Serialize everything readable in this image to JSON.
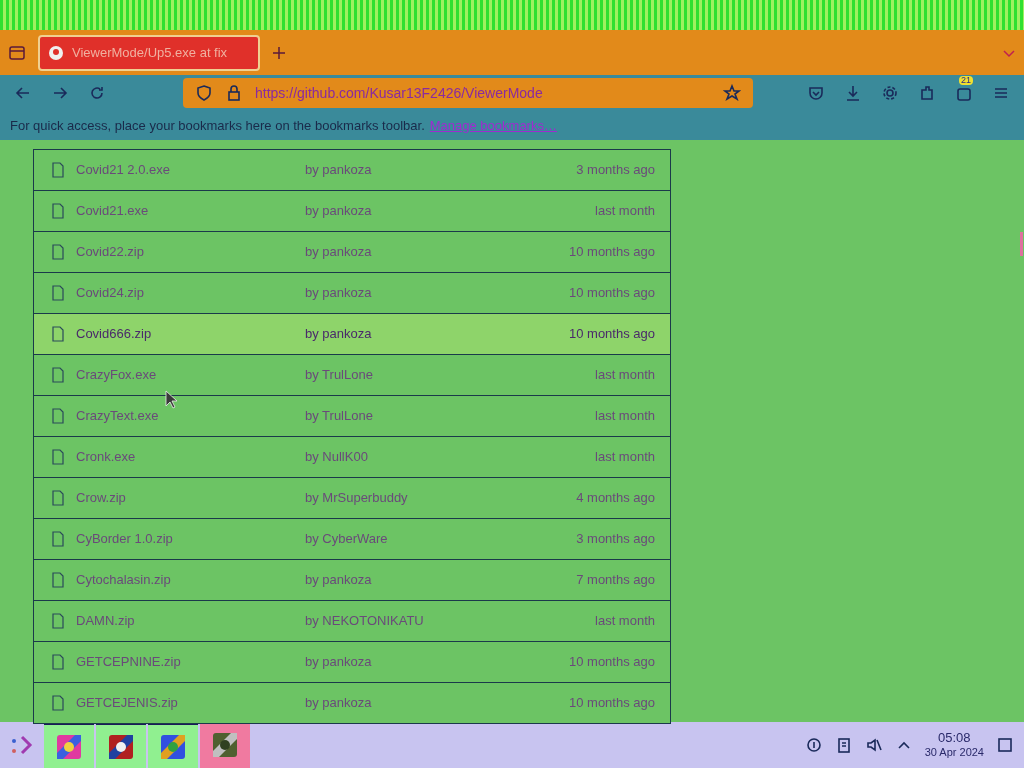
{
  "browser": {
    "tab": {
      "title": "ViewerMode/Up5.exe at fix",
      "selected": true
    },
    "url": "https://github.com/Kusar13F2426/ViewerMode",
    "bookmarks_hint": "For quick access, place your bookmarks here on the bookmarks toolbar.",
    "manage_bookmarks": "Manage bookmarks…",
    "extension_badge": "21"
  },
  "files": [
    {
      "name": "Covid21 2.0.exe",
      "author": "by pankoza",
      "age": "3 months ago",
      "selected": false
    },
    {
      "name": "Covid21.exe",
      "author": "by pankoza",
      "age": "last month",
      "selected": false
    },
    {
      "name": "Covid22.zip",
      "author": "by pankoza",
      "age": "10 months ago",
      "selected": false
    },
    {
      "name": "Covid24.zip",
      "author": "by pankoza",
      "age": "10 months ago",
      "selected": false
    },
    {
      "name": "Covid666.zip",
      "author": "by pankoza",
      "age": "10 months ago",
      "selected": true
    },
    {
      "name": "CrazyFox.exe",
      "author": "by TrulLone",
      "age": "last month",
      "selected": false
    },
    {
      "name": "CrazyText.exe",
      "author": "by TrulLone",
      "age": "last month",
      "selected": false
    },
    {
      "name": "Cronk.exe",
      "author": "by NullK00",
      "age": "last month",
      "selected": false
    },
    {
      "name": "Crow.zip",
      "author": "by MrSuperbuddy",
      "age": "4 months ago",
      "selected": false
    },
    {
      "name": "CyBorder 1.0.zip",
      "author": "by CyberWare",
      "age": "3 months ago",
      "selected": false
    },
    {
      "name": "Cytochalasin.zip",
      "author": "by pankoza",
      "age": "7 months ago",
      "selected": false
    },
    {
      "name": "DAMN.zip",
      "author": "by NEKOTONIKATU",
      "age": "last month",
      "selected": false
    },
    {
      "name": "GETCEPNINE.zip",
      "author": "by pankoza",
      "age": "10 months ago",
      "selected": false
    },
    {
      "name": "GETCEJENIS.zip",
      "author": "by pankoza",
      "age": "10 months ago",
      "selected": false
    }
  ],
  "taskbar": {
    "apps": [
      {
        "running": true,
        "selected": false
      },
      {
        "running": true,
        "selected": false
      },
      {
        "running": true,
        "selected": false
      },
      {
        "running": false,
        "selected": true
      }
    ],
    "time": "05:08",
    "date": "30 Apr 2024"
  }
}
